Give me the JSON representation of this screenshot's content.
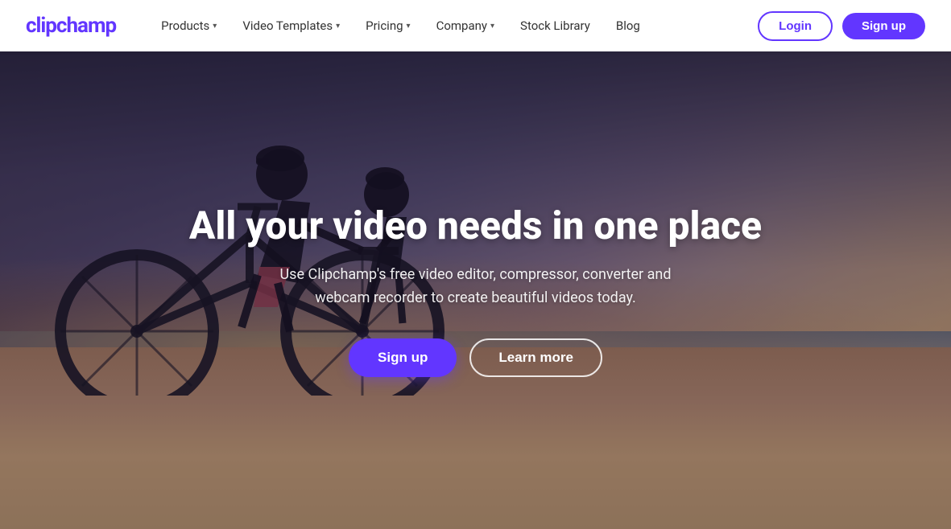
{
  "brand": {
    "logo_text": "clipchamp",
    "logo_color": "#6236ff"
  },
  "navbar": {
    "items": [
      {
        "label": "Products",
        "has_dropdown": true
      },
      {
        "label": "Video Templates",
        "has_dropdown": true
      },
      {
        "label": "Pricing",
        "has_dropdown": true
      },
      {
        "label": "Company",
        "has_dropdown": true
      },
      {
        "label": "Stock Library",
        "has_dropdown": false
      },
      {
        "label": "Blog",
        "has_dropdown": false
      }
    ],
    "login_label": "Login",
    "signup_label": "Sign up"
  },
  "hero": {
    "title": "All your video needs in one place",
    "subtitle": "Use Clipchamp's free video editor, compressor, converter and webcam recorder to create beautiful videos today.",
    "signup_label": "Sign up",
    "learn_more_label": "Learn more"
  }
}
